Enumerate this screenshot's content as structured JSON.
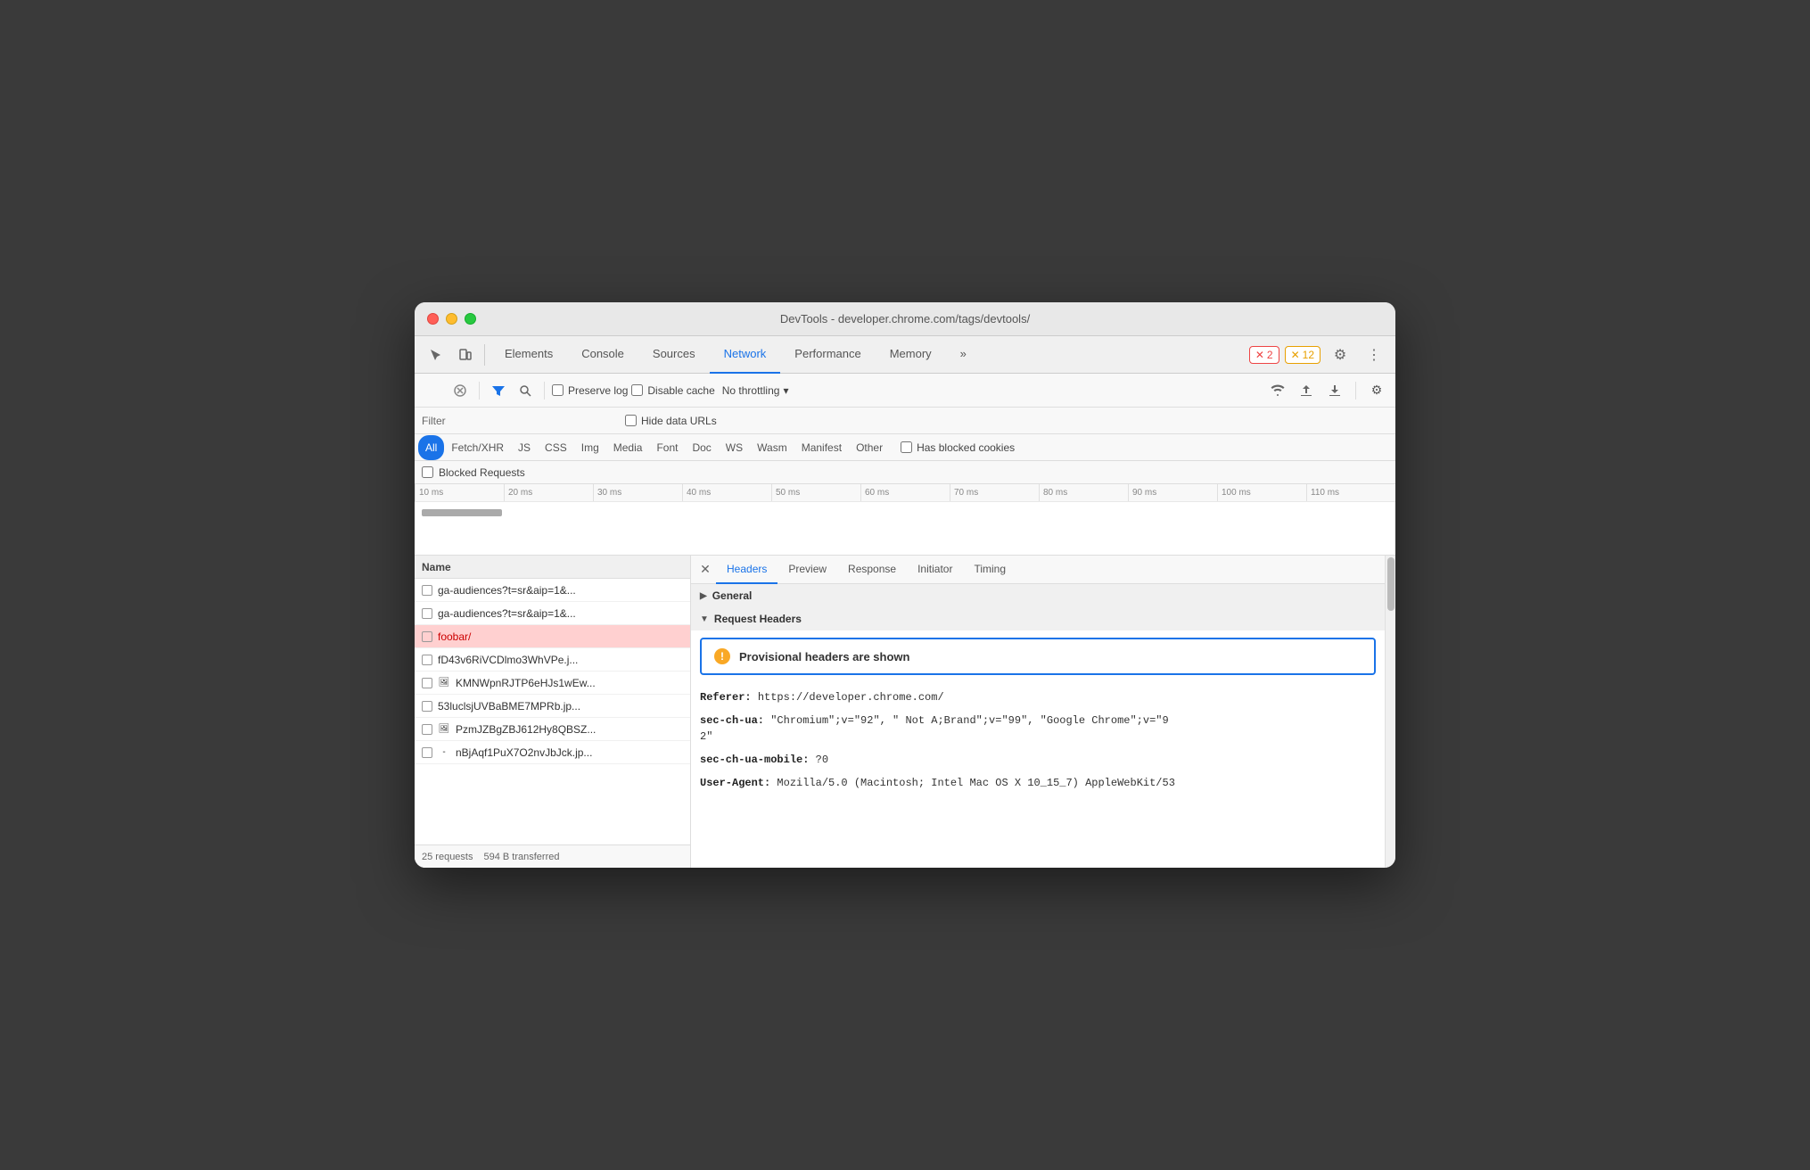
{
  "window": {
    "title": "DevTools - developer.chrome.com/tags/devtools/"
  },
  "tabs": {
    "items": [
      {
        "label": "Elements",
        "active": false
      },
      {
        "label": "Console",
        "active": false
      },
      {
        "label": "Sources",
        "active": false
      },
      {
        "label": "Network",
        "active": true
      },
      {
        "label": "Performance",
        "active": false
      },
      {
        "label": "Memory",
        "active": false
      }
    ],
    "more_label": "»",
    "errors_badge": "2",
    "warnings_badge": "12"
  },
  "toolbar": {
    "preserve_log": "Preserve log",
    "disable_cache": "Disable cache",
    "no_throttling": "No throttling",
    "filter_label": "Filter",
    "hide_data_urls": "Hide data URLs",
    "blocked_requests": "Blocked Requests",
    "has_blocked_cookies": "Has blocked cookies"
  },
  "resource_types": [
    "All",
    "Fetch/XHR",
    "JS",
    "CSS",
    "Img",
    "Media",
    "Font",
    "Doc",
    "WS",
    "Wasm",
    "Manifest",
    "Other"
  ],
  "timeline": {
    "ticks": [
      "10 ms",
      "20 ms",
      "30 ms",
      "40 ms",
      "50 ms",
      "60 ms",
      "70 ms",
      "80 ms",
      "90 ms",
      "100 ms",
      "110 ms"
    ]
  },
  "file_list": {
    "header": "Name",
    "items": [
      {
        "name": "ga-audiences?t=sr&aip=1&...",
        "icon": "☐",
        "selected": false
      },
      {
        "name": "ga-audiences?t=sr&aip=1&...",
        "icon": "☐",
        "selected": false
      },
      {
        "name": "foobar/",
        "icon": "☐",
        "selected": true
      },
      {
        "name": "fD43v6RiVCDlmo3WhVPe.j...",
        "icon": "☐",
        "selected": false
      },
      {
        "name": "KMNWpnRJTP6eHJs1wEw...",
        "icon": "🖼",
        "selected": false
      },
      {
        "name": "53luclsjUVBaBME7MPRb.jp...",
        "icon": "☐",
        "selected": false
      },
      {
        "name": "PzmJZBgZBJ612Hy8QBSZ...",
        "icon": "🖼",
        "selected": false
      },
      {
        "name": "nBjAqf1PuX7O2nvJbJck.jp...",
        "icon": "-",
        "selected": false
      }
    ],
    "requests": "25 requests",
    "transferred": "594 B transferred"
  },
  "headers_panel": {
    "tabs": [
      "Headers",
      "Preview",
      "Response",
      "Initiator",
      "Timing"
    ],
    "active_tab": "Headers",
    "general_section": "General",
    "request_headers_section": "Request Headers",
    "provisional_message": "Provisional headers are shown",
    "headers": [
      {
        "name": "Referer:",
        "value": "https://developer.chrome.com/"
      },
      {
        "name": "sec-ch-ua:",
        "value": "\"Chromium\";v=\"92\", \" Not A;Brand\";v=\"99\", \"Google Chrome\";v=\"92\""
      },
      {
        "name": "sec-ch-ua-mobile:",
        "value": "?0"
      },
      {
        "name": "User-Agent:",
        "value": "Mozilla/5.0 (Macintosh; Intel Mac OS X 10_15_7) AppleWebKit/53"
      }
    ]
  }
}
